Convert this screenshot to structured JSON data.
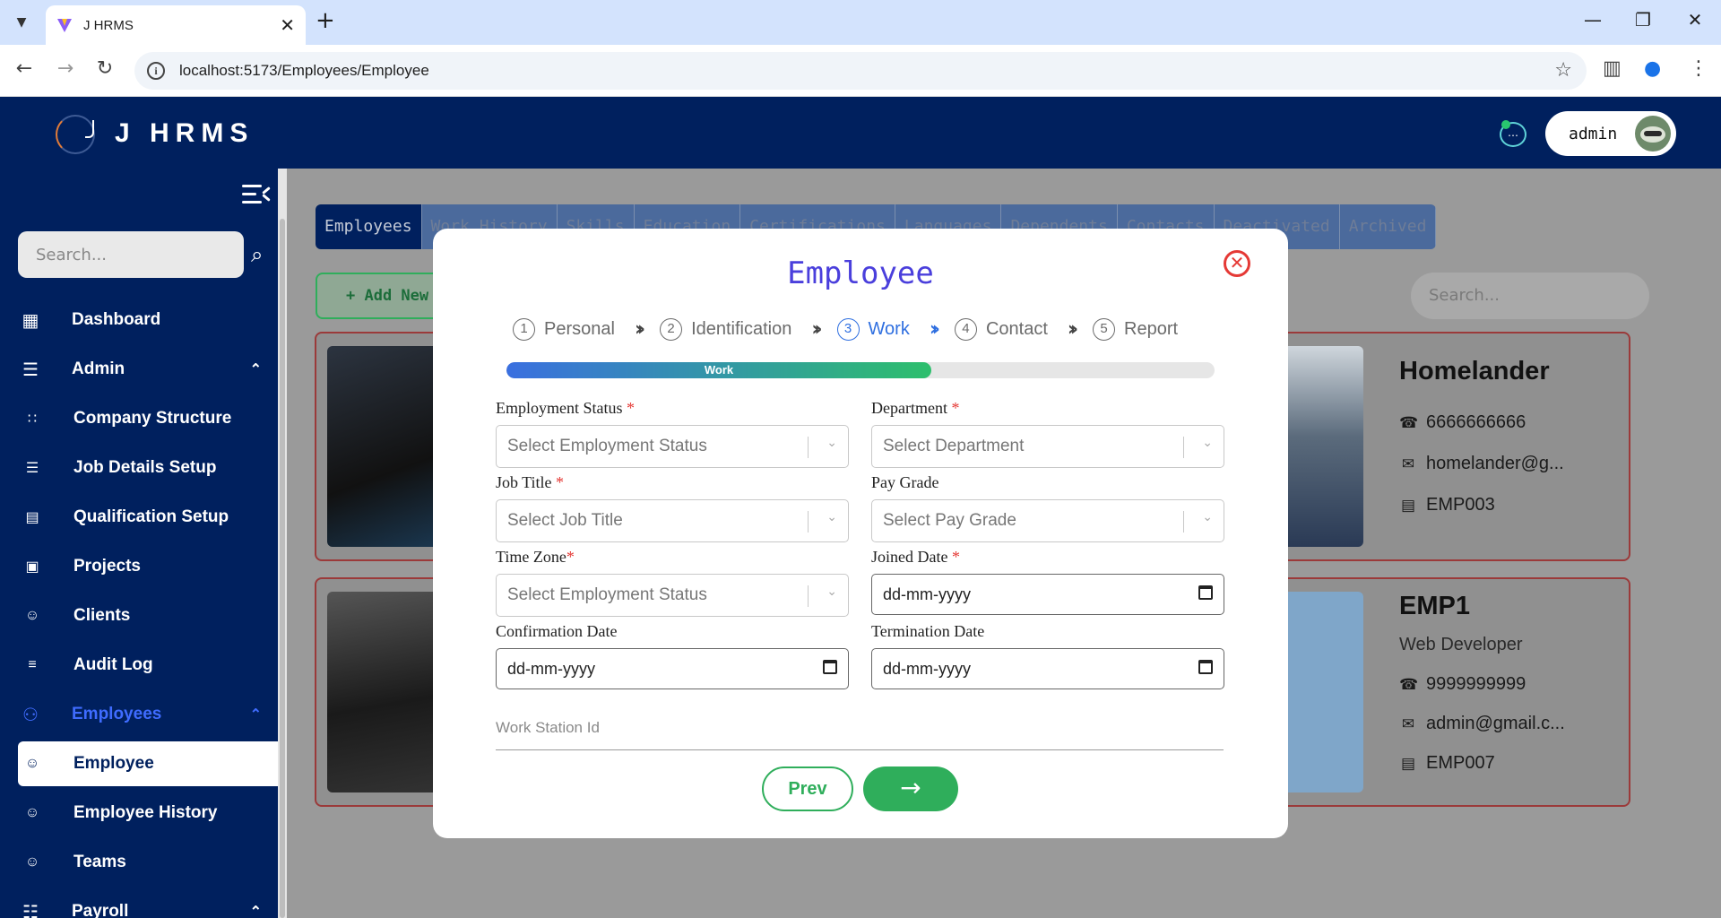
{
  "browser": {
    "tab_title": "J HRMS",
    "url": "localhost:5173/Employees/Employee"
  },
  "header": {
    "brand": "J HRMS",
    "user": "admin"
  },
  "sidebar": {
    "search_placeholder": "Search...",
    "items": [
      {
        "label": "Dashboard"
      },
      {
        "label": "Admin"
      },
      {
        "label": "Company Structure"
      },
      {
        "label": "Job Details Setup"
      },
      {
        "label": "Qualification Setup"
      },
      {
        "label": "Projects"
      },
      {
        "label": "Clients"
      },
      {
        "label": "Audit Log"
      },
      {
        "label": "Employees"
      },
      {
        "label": "Employee"
      },
      {
        "label": "Employee History"
      },
      {
        "label": "Teams"
      },
      {
        "label": "Payroll"
      }
    ]
  },
  "main": {
    "tabs": [
      "Employees",
      "Work History",
      "Skills",
      "Education",
      "Certifications",
      "Languages",
      "Dependents",
      "Contacts",
      "Deactivated",
      "Archived"
    ],
    "add_new": "+ Add New",
    "search_placeholder": "Search...",
    "cards": [
      {
        "name": "Homelander",
        "phone": "6666666666",
        "email": "homelander@g...",
        "id": "EMP003"
      },
      {
        "name": "EMP1",
        "role": "Web Developer",
        "phone": "9999999999",
        "email": "admin@gmail.c...",
        "id": "EMP007"
      }
    ]
  },
  "modal": {
    "title": "Employee",
    "steps": [
      {
        "num": "1",
        "label": "Personal"
      },
      {
        "num": "2",
        "label": "Identification"
      },
      {
        "num": "3",
        "label": "Work"
      },
      {
        "num": "4",
        "label": "Contact"
      },
      {
        "num": "5",
        "label": "Report"
      }
    ],
    "progress_label": "Work",
    "progress_fraction": 0.6,
    "fields": {
      "employment_status": {
        "label": "Employment Status",
        "placeholder": "Select Employment Status"
      },
      "department": {
        "label": "Department",
        "placeholder": "Select Department"
      },
      "job_title": {
        "label": "Job Title",
        "placeholder": "Select Job Title"
      },
      "pay_grade": {
        "label": "Pay Grade",
        "placeholder": "Select Pay Grade"
      },
      "time_zone": {
        "label": "Time Zone",
        "placeholder": "Select Employment Status"
      },
      "joined_date": {
        "label": "Joined Date",
        "value": "dd-mm-yyyy"
      },
      "confirmation_date": {
        "label": "Confirmation Date",
        "value": "dd-mm-yyyy"
      },
      "termination_date": {
        "label": "Termination Date",
        "value": "dd-mm-yyyy"
      },
      "work_station": {
        "placeholder": "Work Station Id"
      }
    },
    "prev_label": "Prev",
    "required_mark": "*"
  },
  "colors": {
    "navy": "#00205e",
    "accent_green": "#2fae5b",
    "title_purple": "#4a3fdc",
    "step_blue": "#2f6fe0",
    "required_red": "#e53935"
  },
  "icons": [
    "search-icon",
    "close-icon",
    "arrow-right-icon",
    "calendar-icon",
    "chat-icon",
    "star-icon"
  ]
}
